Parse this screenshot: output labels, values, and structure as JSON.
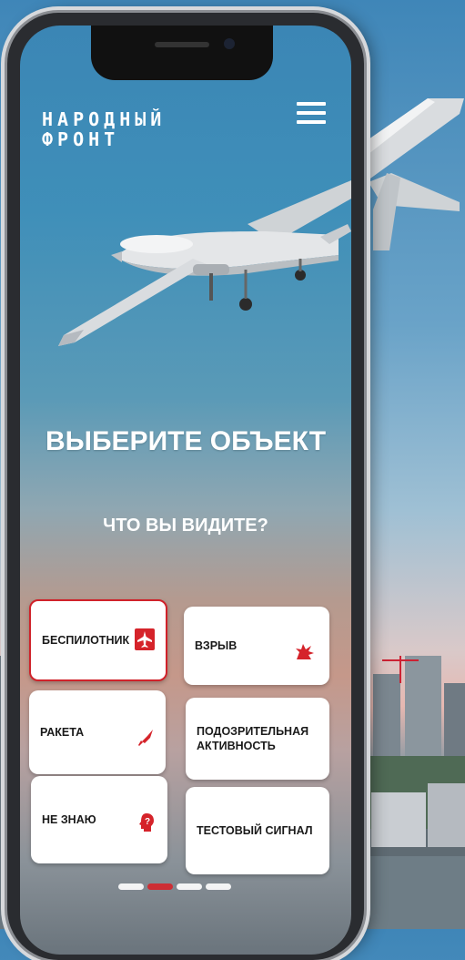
{
  "app": {
    "logo_line1": "НАРОДНЫЙ",
    "logo_line2": "ФРОНТ",
    "menu_icon": "hamburger-icon"
  },
  "main": {
    "title": "ВЫБЕРИТЕ ОБЪЕКТ",
    "subtitle": "ЧТО ВЫ ВИДИТЕ?"
  },
  "options": [
    {
      "label": "БЕСПИЛОТНИК",
      "icon": "drone-icon",
      "selected": true
    },
    {
      "label": "ВЗРЫВ",
      "icon": "explosion-icon",
      "selected": false
    },
    {
      "label": "РАКЕТА",
      "icon": "missile-icon",
      "selected": false
    },
    {
      "label": "ПОДОЗРИТЕЛЬНАЯ АКТИВНОСТЬ",
      "icon": "",
      "selected": false
    },
    {
      "label": "НЕ ЗНАЮ",
      "icon": "question-head-icon",
      "selected": false
    },
    {
      "label": "ТЕСТОВЫЙ СИГНАЛ",
      "icon": "",
      "selected": false
    }
  ],
  "pagination": {
    "total": 4,
    "active_index": 1
  },
  "colors": {
    "accent": "#d5232a",
    "card": "#ffffff",
    "text": "#1a1a1a"
  }
}
